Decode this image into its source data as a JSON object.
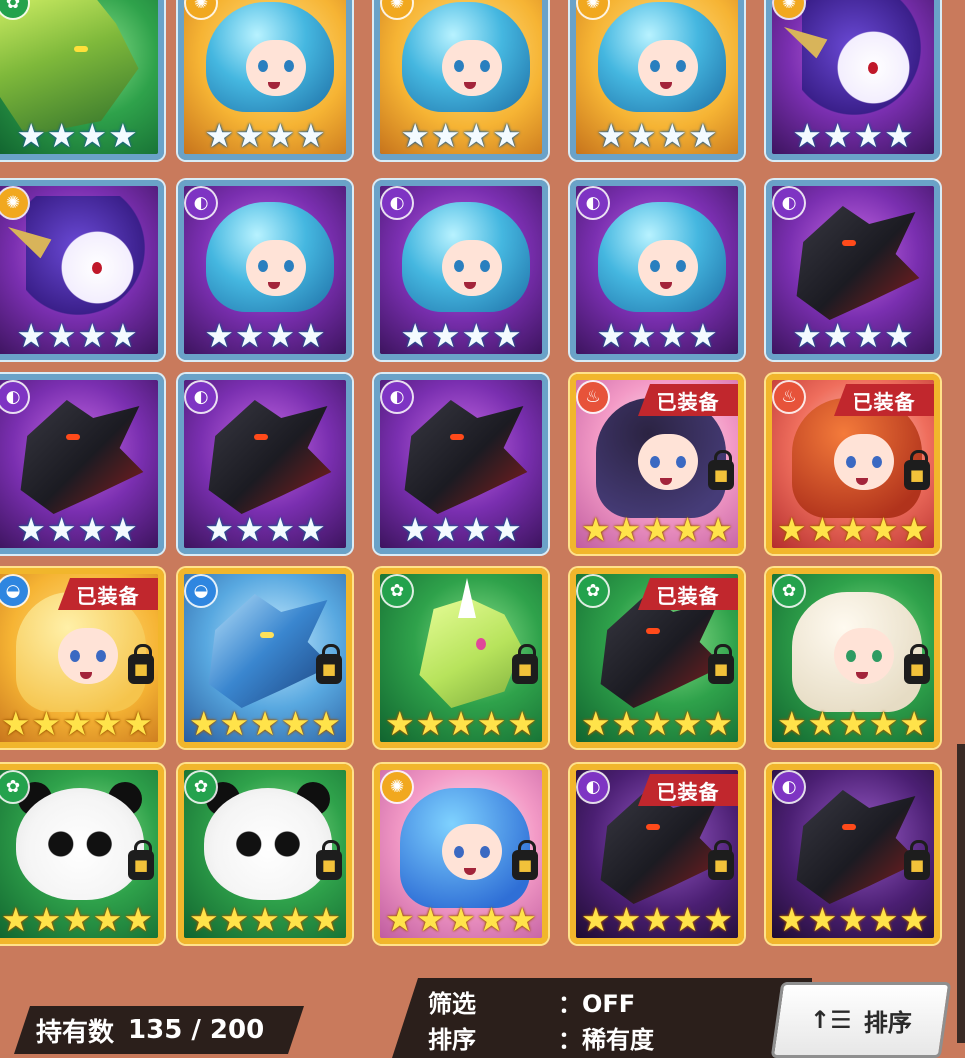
{
  "cards": [
    {
      "row": 0,
      "col": 0,
      "element": "wood",
      "element_symbol": "✿",
      "rarity": 4,
      "equipped": false,
      "locked": false,
      "art": "green",
      "char": "dragon-green"
    },
    {
      "row": 0,
      "col": 1,
      "element": "light",
      "element_symbol": "✺",
      "rarity": 4,
      "equipped": false,
      "locked": false,
      "art": "yellow",
      "char": "cyan-girl"
    },
    {
      "row": 0,
      "col": 2,
      "element": "light",
      "element_symbol": "✺",
      "rarity": 4,
      "equipped": false,
      "locked": false,
      "art": "yellow",
      "char": "cyan-girl"
    },
    {
      "row": 0,
      "col": 3,
      "element": "light",
      "element_symbol": "✺",
      "rarity": 4,
      "equipped": false,
      "locked": false,
      "art": "yellow",
      "char": "cyan-girl"
    },
    {
      "row": 0,
      "col": 4,
      "element": "light",
      "element_symbol": "✺",
      "rarity": 4,
      "equipped": false,
      "locked": false,
      "art": "purple",
      "char": "unicorn"
    },
    {
      "row": 1,
      "col": 0,
      "element": "light",
      "element_symbol": "✺",
      "rarity": 4,
      "equipped": false,
      "locked": false,
      "art": "purple",
      "char": "unicorn"
    },
    {
      "row": 1,
      "col": 1,
      "element": "dark",
      "element_symbol": "◐",
      "rarity": 4,
      "equipped": false,
      "locked": false,
      "art": "purple",
      "char": "cyan-girl"
    },
    {
      "row": 1,
      "col": 2,
      "element": "dark",
      "element_symbol": "◐",
      "rarity": 4,
      "equipped": false,
      "locked": false,
      "art": "purple",
      "char": "cyan-girl"
    },
    {
      "row": 1,
      "col": 3,
      "element": "dark",
      "element_symbol": "◐",
      "rarity": 4,
      "equipped": false,
      "locked": false,
      "art": "purple",
      "char": "cyan-girl"
    },
    {
      "row": 1,
      "col": 4,
      "element": "dark",
      "element_symbol": "◐",
      "rarity": 4,
      "equipped": false,
      "locked": false,
      "art": "purple",
      "char": "dark-dragon"
    },
    {
      "row": 2,
      "col": 0,
      "element": "dark",
      "element_symbol": "◐",
      "rarity": 4,
      "equipped": false,
      "locked": false,
      "art": "purple",
      "char": "dark-dragon"
    },
    {
      "row": 2,
      "col": 1,
      "element": "dark",
      "element_symbol": "◐",
      "rarity": 4,
      "equipped": false,
      "locked": false,
      "art": "purple",
      "char": "dark-dragon"
    },
    {
      "row": 2,
      "col": 2,
      "element": "dark",
      "element_symbol": "◐",
      "rarity": 4,
      "equipped": false,
      "locked": false,
      "art": "purple",
      "char": "dark-dragon"
    },
    {
      "row": 2,
      "col": 3,
      "element": "fire",
      "element_symbol": "♨",
      "rarity": 5,
      "equipped": true,
      "locked": true,
      "art": "pink",
      "char": "girl-dark"
    },
    {
      "row": 2,
      "col": 4,
      "element": "fire",
      "element_symbol": "♨",
      "rarity": 5,
      "equipped": true,
      "locked": true,
      "art": "red",
      "char": "girl-red"
    },
    {
      "row": 3,
      "col": 0,
      "element": "water",
      "element_symbol": "◒",
      "rarity": 5,
      "equipped": true,
      "locked": true,
      "art": "yellow",
      "char": "girl-blonde"
    },
    {
      "row": 3,
      "col": 1,
      "element": "water",
      "element_symbol": "◒",
      "rarity": 5,
      "equipped": false,
      "locked": true,
      "art": "blue",
      "char": "blue-dragon"
    },
    {
      "row": 3,
      "col": 2,
      "element": "wood",
      "element_symbol": "✿",
      "rarity": 5,
      "equipped": false,
      "locked": true,
      "art": "green",
      "char": "dino"
    },
    {
      "row": 3,
      "col": 3,
      "element": "wood",
      "element_symbol": "✿",
      "rarity": 5,
      "equipped": true,
      "locked": true,
      "art": "green",
      "char": "dark-dragon"
    },
    {
      "row": 3,
      "col": 4,
      "element": "wood",
      "element_symbol": "✿",
      "rarity": 5,
      "equipped": false,
      "locked": true,
      "art": "green",
      "char": "girl-white"
    },
    {
      "row": 4,
      "col": 0,
      "element": "wood",
      "element_symbol": "✿",
      "rarity": 5,
      "equipped": false,
      "locked": true,
      "art": "green",
      "char": "panda"
    },
    {
      "row": 4,
      "col": 1,
      "element": "wood",
      "element_symbol": "✿",
      "rarity": 5,
      "equipped": false,
      "locked": true,
      "art": "green",
      "char": "panda"
    },
    {
      "row": 4,
      "col": 2,
      "element": "light",
      "element_symbol": "✺",
      "rarity": 5,
      "equipped": false,
      "locked": true,
      "art": "pink",
      "char": "girl-blue"
    },
    {
      "row": 4,
      "col": 3,
      "element": "dark",
      "element_symbol": "◐",
      "rarity": 5,
      "equipped": true,
      "locked": true,
      "art": "dark",
      "char": "dark-dragon"
    },
    {
      "row": 4,
      "col": 4,
      "element": "dark",
      "element_symbol": "◐",
      "rarity": 5,
      "equipped": false,
      "locked": true,
      "art": "dark",
      "char": "dark-dragon"
    }
  ],
  "labels": {
    "equipped": "已装备",
    "lock_glyph": "🔒"
  },
  "inventory": {
    "count_label": "持有数",
    "count_value": "135",
    "count_sep": "/",
    "count_max": "200"
  },
  "filter": {
    "filter_label": "筛选",
    "filter_value": "：OFF",
    "sort_label": "排序",
    "sort_value": "：稀有度"
  },
  "sort_button": {
    "icon": "sort-icon",
    "icon_glyph": "↑☰",
    "label": "排序"
  },
  "colors": {
    "background": "#c97a5c",
    "equip_banner": "#c1272d",
    "frame_4star": "#6aa2c8",
    "frame_5star": "#f1b62c"
  }
}
